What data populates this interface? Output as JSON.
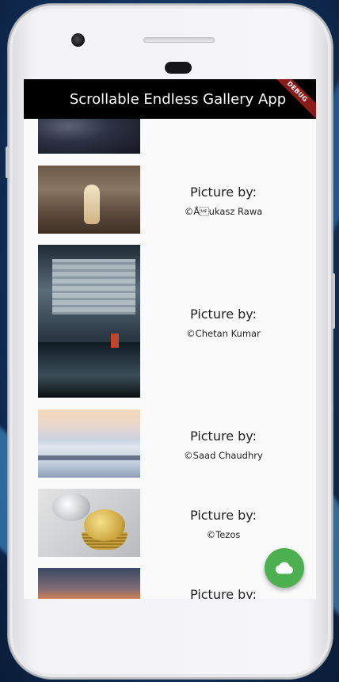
{
  "app": {
    "title": "Scrollable Endless Gallery App",
    "debug_label": "DEBUG"
  },
  "gallery": {
    "items": [
      {
        "picture_label": "",
        "credit": "",
        "image": "dark rocks photo"
      },
      {
        "picture_label": "Picture by:",
        "credit": "©Å\u001fukasz Rawa",
        "image": "dog running in forest photo"
      },
      {
        "picture_label": "Picture by:",
        "credit": "©Chetan Kumar",
        "image": "city reflection photo"
      },
      {
        "picture_label": "Picture by:",
        "credit": "©Saad Chaudhry",
        "image": "snowy landscape photo"
      },
      {
        "picture_label": "Picture by:",
        "credit": "©Tezos",
        "image": "stacked coins photo"
      },
      {
        "picture_label": "Picture by:",
        "credit": "",
        "image": "sunset landscape photo"
      }
    ]
  },
  "fab": {
    "icon": "cloud-icon",
    "color": "#4caf50"
  },
  "colors": {
    "appbar": "#000000",
    "screen": "#fafafa",
    "debug_banner": "#8b1a1a"
  }
}
